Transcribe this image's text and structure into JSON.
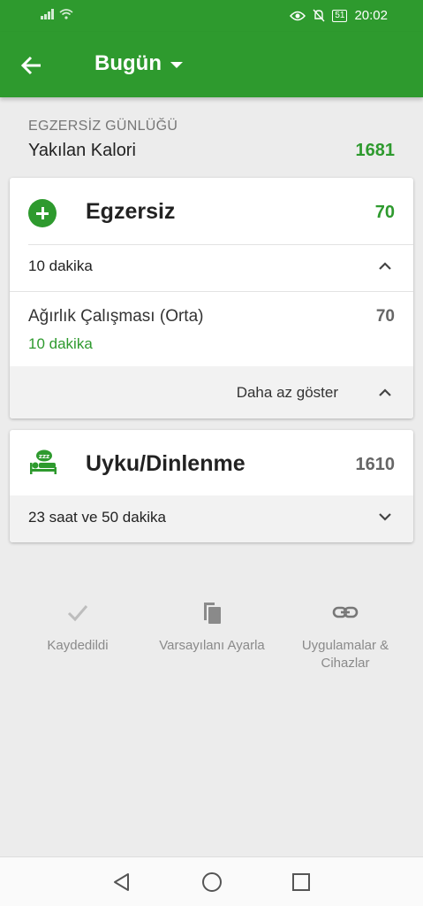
{
  "status_bar": {
    "time": "20:02",
    "battery": "51"
  },
  "appbar": {
    "title": "Bugün"
  },
  "summary": {
    "section_label": "EGZERSİZ GÜNLÜĞÜ",
    "calorie_label": "Yakılan Kalori",
    "calorie_value": "1681"
  },
  "exercise_card": {
    "title": "Egzersiz",
    "value": "70",
    "total_duration": "10 dakika",
    "item": {
      "name": "Ağırlık Çalışması (Orta)",
      "value": "70",
      "duration": "10 dakika"
    },
    "show_less": "Daha az göster"
  },
  "sleep_card": {
    "title": "Uyku/Dinlenme",
    "value": "1610",
    "duration": "23 saat ve 50 dakika"
  },
  "actions": [
    {
      "label": "Kaydedildi",
      "icon": "check-icon"
    },
    {
      "label": "Varsayılanı Ayarla",
      "icon": "copy-icon"
    },
    {
      "label": "Uygulamalar & Cihazlar",
      "icon": "link-icon"
    }
  ],
  "nav": {
    "icons": [
      "back-triangle-icon",
      "home-circle-icon",
      "recents-square-icon"
    ]
  },
  "colors": {
    "primary": "#2e9a2e",
    "background": "#ececec"
  }
}
